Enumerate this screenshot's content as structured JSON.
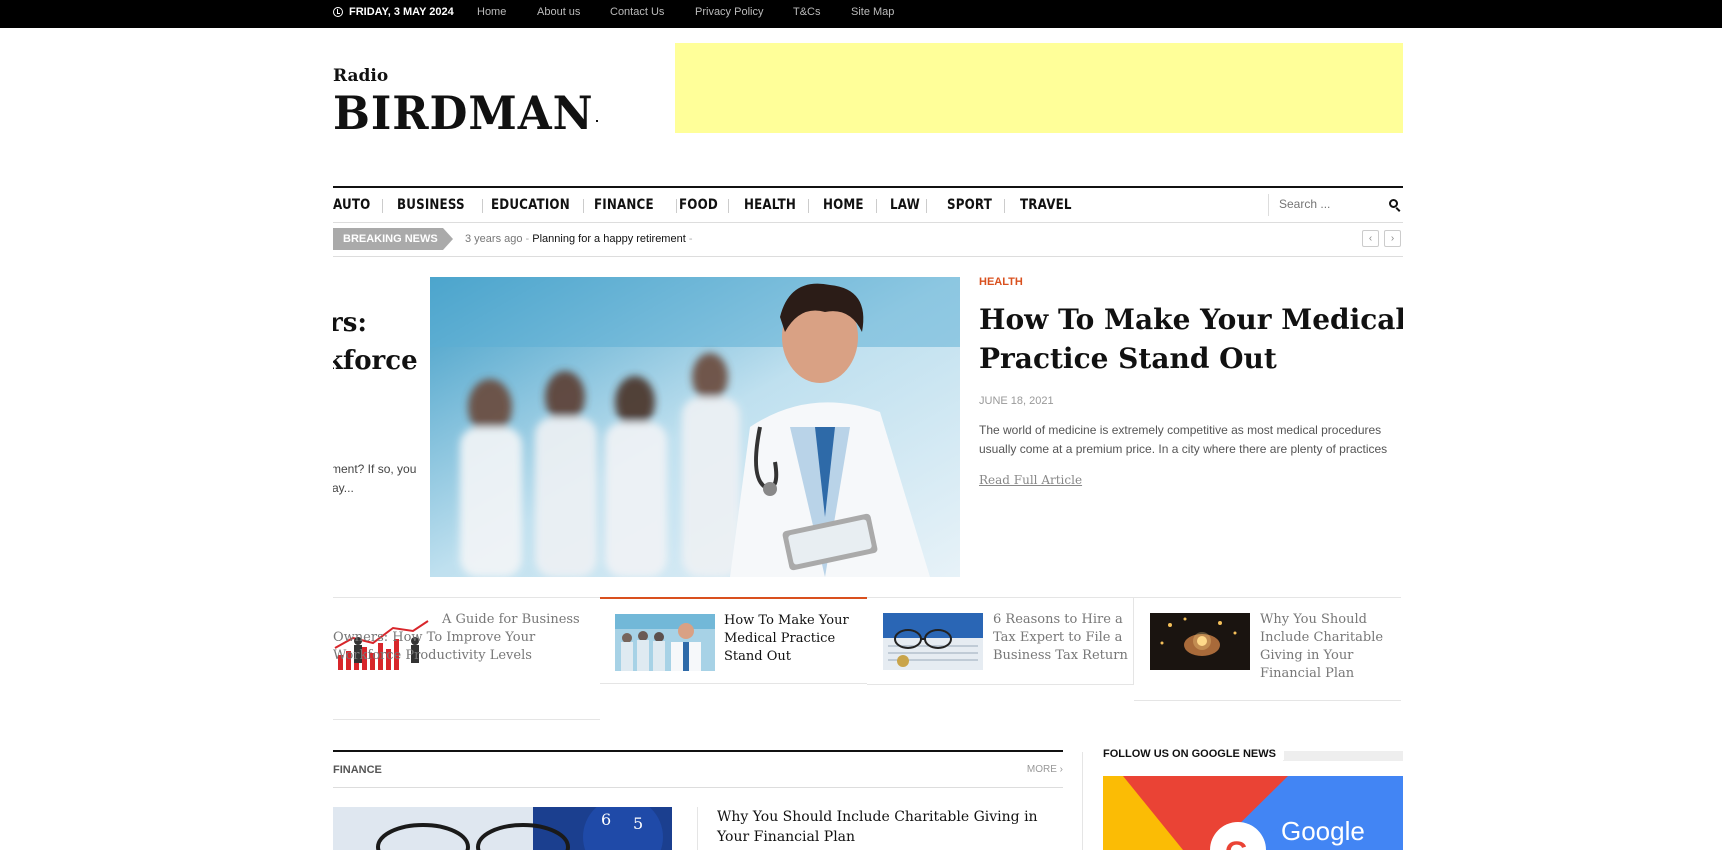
{
  "topbar": {
    "date": "FRIDAY, 3 MAY 2024",
    "links": [
      "Home",
      "About us",
      "Contact Us",
      "Privacy Policy",
      "T&Cs",
      "Site Map"
    ]
  },
  "logo": {
    "small": "Radio",
    "big": "BIRDMAN"
  },
  "nav": {
    "items": [
      "AUTO",
      "BUSINESS",
      "EDUCATION",
      "FINANCE",
      "FOOD",
      "HEALTH",
      "HOME",
      "LAW",
      "SPORT",
      "TRAVEL"
    ],
    "search_placeholder": "Search ..."
  },
  "breaking": {
    "label": "BREAKING NEWS",
    "ago": "3 years ago",
    "headline": "Planning for a happy retirement"
  },
  "hero": {
    "prev_title_lines": [
      "rs:",
      "kforce"
    ],
    "prev_excerpt_lines": [
      "ment? If so, you",
      "ay..."
    ],
    "category": "HEALTH",
    "title_lines": [
      "How To Make Your Medical",
      "Practice Stand Out"
    ],
    "date": "JUNE 18, 2021",
    "excerpt_lines": [
      "The world of medicine is extremely competitive as most medical procedures",
      "usually come at a premium price. In a city where there are plenty of practices"
    ],
    "read_more": "Read Full Article"
  },
  "carousel": [
    {
      "title": "A Guide for Business Owners: How To Improve Your Workforce Productivity Levels",
      "active": false
    },
    {
      "title": "How To Make Your Medical Practice Stand Out",
      "active": true
    },
    {
      "title": "6 Reasons to Hire a Tax Expert to File a Business Tax Return",
      "active": false
    },
    {
      "title": "Why You Should Include Charitable Giving in Your Financial Plan",
      "active": false
    }
  ],
  "finance": {
    "label": "FINANCE",
    "more": "MORE",
    "article_title": "Why You Should Include Charitable Giving in Your Financial Plan"
  },
  "sidebar": {
    "google_heading": "FOLLOW US ON GOOGLE NEWS",
    "google_wordmark": "Google"
  },
  "colors": {
    "accent": "#d9501e",
    "ad": "#ffff99"
  }
}
